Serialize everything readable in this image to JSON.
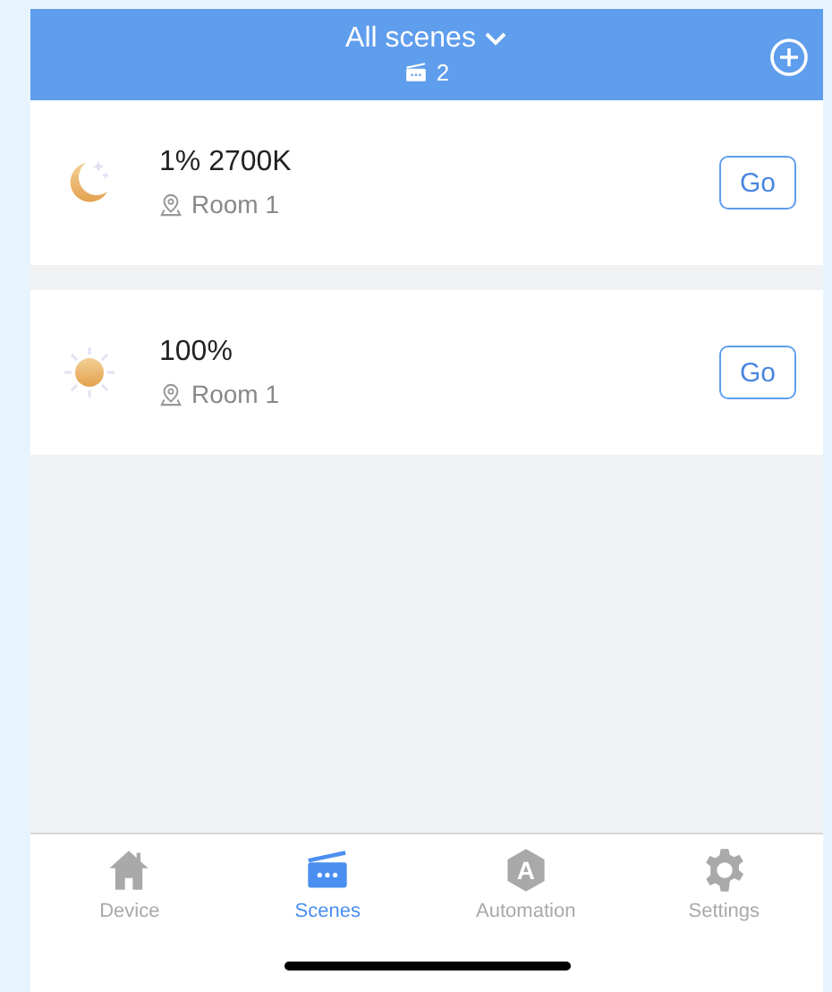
{
  "header": {
    "title": "All scenes",
    "count": "2"
  },
  "scenes": [
    {
      "kind": "night",
      "name": "1% 2700K",
      "room": "Room 1",
      "button": "Go"
    },
    {
      "kind": "day",
      "name": "100%",
      "room": "Room 1",
      "button": "Go"
    }
  ],
  "tabs": [
    {
      "kind": "device",
      "label": "Device",
      "selected": false
    },
    {
      "kind": "scenes",
      "label": "Scenes",
      "selected": true
    },
    {
      "kind": "automation",
      "icon_text": "A",
      "label": "Automation",
      "selected": false
    },
    {
      "kind": "settings",
      "label": "Settings",
      "selected": false
    }
  ]
}
